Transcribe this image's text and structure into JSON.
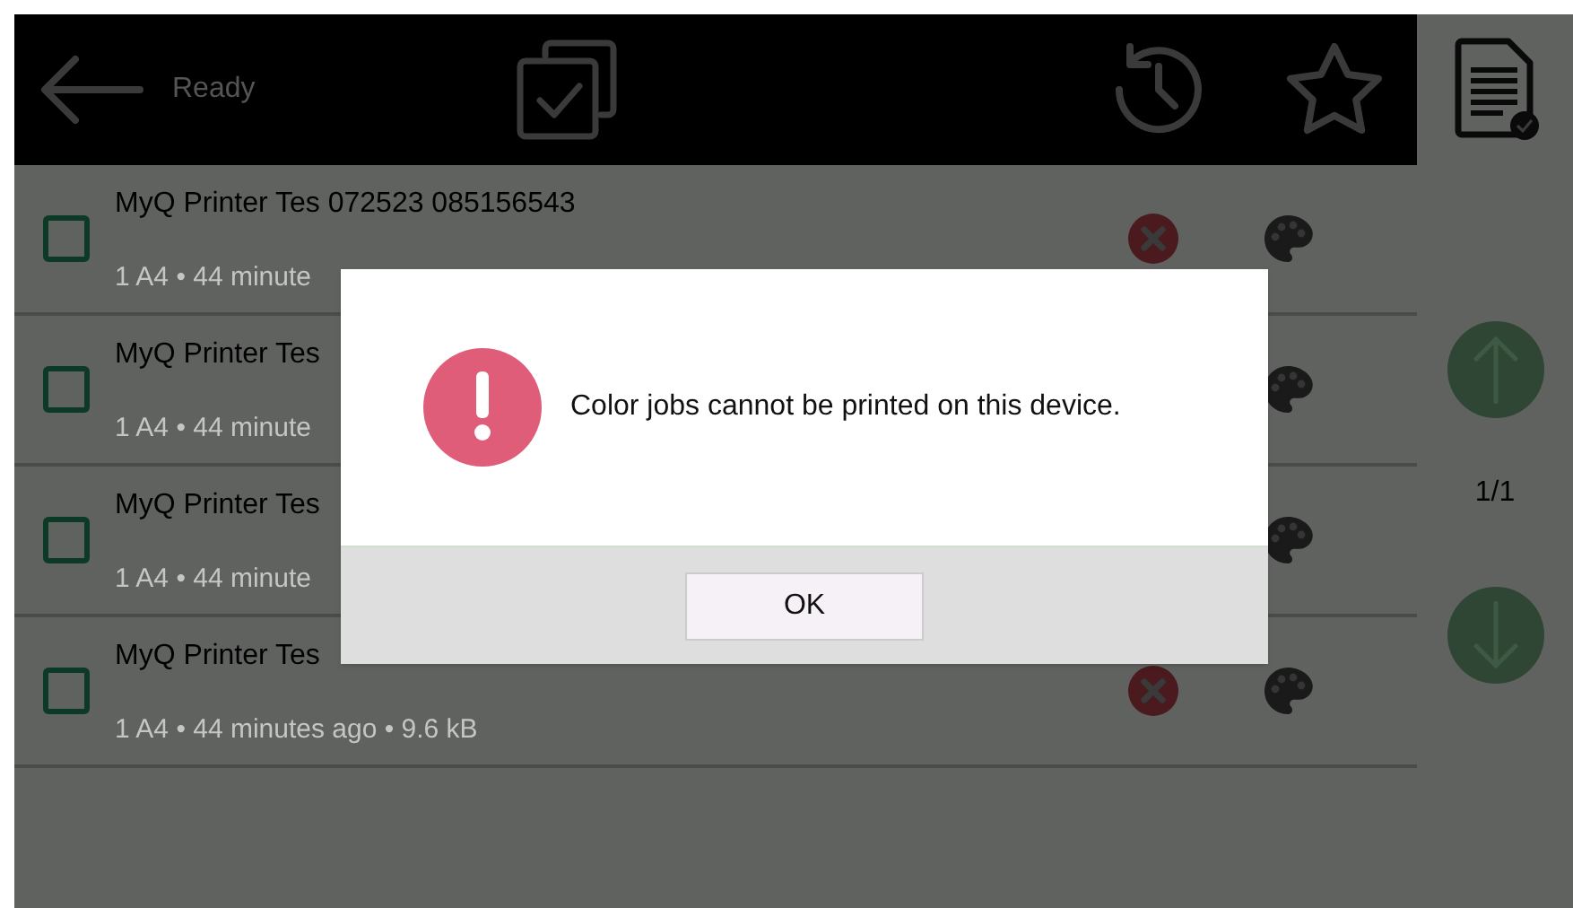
{
  "header": {
    "status": "Ready",
    "tabs": [
      {
        "kind": "history",
        "selected": false
      },
      {
        "kind": "favorites",
        "selected": false
      },
      {
        "kind": "jobs",
        "selected": true
      }
    ]
  },
  "jobs": [
    {
      "title": "MyQ Printer Tes 072523 085156543",
      "details": "1 A4 • 44 minute",
      "checked": false,
      "error": true
    },
    {
      "title": "MyQ Printer Tes",
      "details": "1 A4 • 44 minute",
      "checked": false,
      "error": false
    },
    {
      "title": "MyQ Printer Tes",
      "details": "1 A4 • 44 minute",
      "checked": false,
      "error": false
    },
    {
      "title": "MyQ Printer Tes",
      "details": "1 A4 • 44 minutes ago • 9.6 kB",
      "checked": false,
      "error": true
    }
  ],
  "pager": {
    "page": "1/1"
  },
  "dialog": {
    "message": "Color jobs cannot be printed on this device.",
    "button": "OK"
  }
}
